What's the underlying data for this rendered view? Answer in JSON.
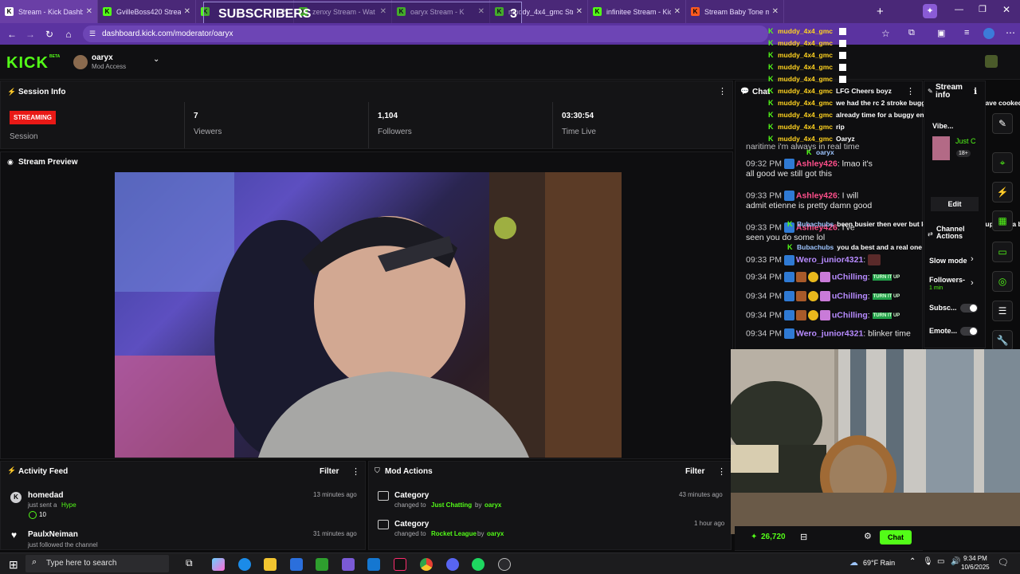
{
  "browser": {
    "tabs": [
      {
        "title": "Stream - Kick Dashb",
        "color": "#ffffff",
        "active": true
      },
      {
        "title": "GvilleBoss420 Strean",
        "color": "#53fc18",
        "active": false
      },
      {
        "title": "",
        "color": "#53fc18",
        "active": false
      },
      {
        "title": "zenxy Stream - Wat",
        "color": "#53fc18",
        "active": false
      },
      {
        "title": "oaryx Stream - K",
        "color": "#53fc18",
        "active": false
      },
      {
        "title": "muddy_4x4_gmc Str",
        "color": "#53fc18",
        "active": false
      },
      {
        "title": "infinitee Stream - Kic",
        "color": "#53fc18",
        "active": false
      },
      {
        "title": "Stream Baby Tone m",
        "color": "#ff5a1f",
        "active": false
      }
    ],
    "url": "dashboard.kick.com/moderator/oaryx",
    "subscribers_overlay": {
      "label": "SUBSCRIBERS",
      "count": "3"
    }
  },
  "header": {
    "logo": "KICK",
    "beta": "BETA",
    "channel": "oaryx",
    "access": "Mod Access"
  },
  "session": {
    "title": "Session Info",
    "status": "STREAMING",
    "session_label": "Session",
    "viewers": "7",
    "viewers_label": "Viewers",
    "followers": "1,104",
    "followers_label": "Followers",
    "time_live": "03:30:54",
    "time_live_label": "Time Live"
  },
  "preview": {
    "title": "Stream Preview"
  },
  "activity": {
    "title": "Activity Feed",
    "filter": "Filter",
    "items": [
      {
        "user": "homedad",
        "action": "just sent a",
        "highlight": "Hype",
        "amount": "10",
        "time": "13 minutes ago"
      },
      {
        "user": "PaulxNeiman",
        "action": "just followed the channel",
        "highlight": "",
        "amount": "",
        "time": "31 minutes ago"
      }
    ]
  },
  "mod_actions": {
    "title": "Mod Actions",
    "filter": "Filter",
    "items": [
      {
        "title": "Category",
        "pre": "changed to",
        "value": "Just Chatting",
        "by": "by",
        "user": "oaryx",
        "time": "43 minutes ago"
      },
      {
        "title": "Category",
        "pre": "changed to",
        "value": "Rocket League",
        "by": "by",
        "user": "oaryx",
        "time": "1 hour ago"
      }
    ]
  },
  "chat": {
    "title": "Chat",
    "partial_top": "naritime i'm always in real time",
    "messages": [
      {
        "time": "09:32 PM",
        "user": "Ashley426",
        "text": "lmao it's",
        "cont": "all good we still got this"
      },
      {
        "time": "09:33 PM",
        "user": "Ashley426",
        "text": "I will",
        "cont": "admit etienne is pretty damn good"
      },
      {
        "time": "09:33 PM",
        "user": "Ashley426",
        "text": "I've",
        "cont": "seen you do some lol"
      },
      {
        "time": "09:33 PM",
        "user": "Wero_junior4321",
        "text": "",
        "cont": ""
      },
      {
        "time": "09:34 PM",
        "user": "uChilling",
        "text": "TURN IT UP",
        "cont": ""
      },
      {
        "time": "09:34 PM",
        "user": "uChilling",
        "text": "TURN IT UP",
        "cont": ""
      },
      {
        "time": "09:34 PM",
        "user": "uChilling",
        "text": "TURN IT UP",
        "cont": ""
      },
      {
        "time": "09:34 PM",
        "user": "Wero_junior4321",
        "text": "blinker time",
        "cont": ""
      }
    ],
    "points": "26,720",
    "send": "Chat"
  },
  "overlay_chat": [
    {
      "user": "muddy_4x4_gmc",
      "text": ""
    },
    {
      "user": "muddy_4x4_gmc",
      "text": ""
    },
    {
      "user": "muddy_4x4_gmc",
      "text": ""
    },
    {
      "user": "muddy_4x4_gmc",
      "text": ""
    },
    {
      "user": "muddy_4x4_gmc",
      "text": ""
    },
    {
      "user": "muddy_4x4_gmc",
      "text": "LFG Cheers boyz"
    },
    {
      "user": "muddy_4x4_gmc",
      "text": "we had the rc 2 stroke buggy out earlier may have cooked the m"
    },
    {
      "user": "muddy_4x4_gmc",
      "text": "already time for a buggy engine rebuild lmao"
    },
    {
      "user": "muddy_4x4_gmc",
      "text": "rip"
    },
    {
      "user": "muddy_4x4_gmc",
      "text": "Oaryz"
    }
  ],
  "overlay_misc": [
    {
      "user": "oaryx",
      "text": ""
    },
    {
      "user": "Bubachubs",
      "text": "been busier then ever but love the grind and support ya bro"
    },
    {
      "user": "Bubachubs",
      "text": "you da best and a real one and you know that"
    }
  ],
  "stream_info": {
    "title": "Stream info",
    "vibe": "Vibe...",
    "category": "Just C",
    "age": "18+",
    "edit": "Edit",
    "channel_actions": "Channel Actions",
    "rows": [
      {
        "label": "Slow mode",
        "sub": ""
      },
      {
        "label": "Followers-",
        "sub": "1 min"
      },
      {
        "label": "Subsc...",
        "sub": ""
      },
      {
        "label": "Emote...",
        "sub": ""
      }
    ]
  },
  "taskbar": {
    "search": "Type here to search",
    "weather": "69°F Rain",
    "time": "9:34 PM",
    "date": "10/6/2025"
  }
}
